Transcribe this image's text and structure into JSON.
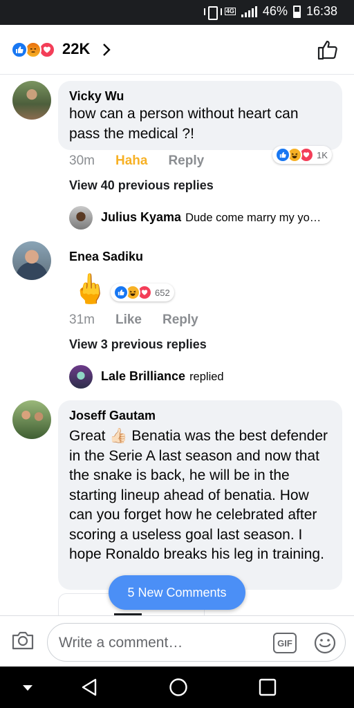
{
  "status_bar": {
    "network": "4G",
    "battery": "46%",
    "time": "16:38"
  },
  "header": {
    "reaction_count": "22K",
    "reactions": [
      "like-icon",
      "angry-icon",
      "love-icon"
    ]
  },
  "comments": [
    {
      "author": "Vicky Wu",
      "text": "how can a person without heart can pass the medical ?!",
      "time": "30m",
      "reaction_label": "Haha",
      "reply_label": "Reply",
      "reaction_count": "1K",
      "view_previous": "View 40 previous replies",
      "reply_preview": {
        "author": "Julius Kyama",
        "text": "Dude come marry my yo…"
      }
    },
    {
      "author": "Enea Sadiku",
      "text": "🖕",
      "time": "31m",
      "reaction_label": "Like",
      "reply_label": "Reply",
      "reaction_count": "652",
      "view_previous": "View 3 previous replies",
      "reply_preview": {
        "author": "Lale Brilliance",
        "text": "replied"
      }
    },
    {
      "author": "Joseff Gautam",
      "text": "Great 👍🏻 Benatia was the best defender in the Serie A last season and now that the snake is back, he will be in the starting lineup ahead of benatia. How can you forget how he celebrated after scoring a useless goal last season. I hope Ronaldo breaks his leg in training."
    }
  ],
  "new_comments_label": "5 New Comments",
  "composer": {
    "placeholder": "Write a comment…",
    "gif_label": "GIF"
  },
  "colors": {
    "like_blue": "#1877f2",
    "haha_yellow": "#f7b125",
    "love_red": "#f33e58",
    "pill_blue": "#4b8ff6"
  }
}
